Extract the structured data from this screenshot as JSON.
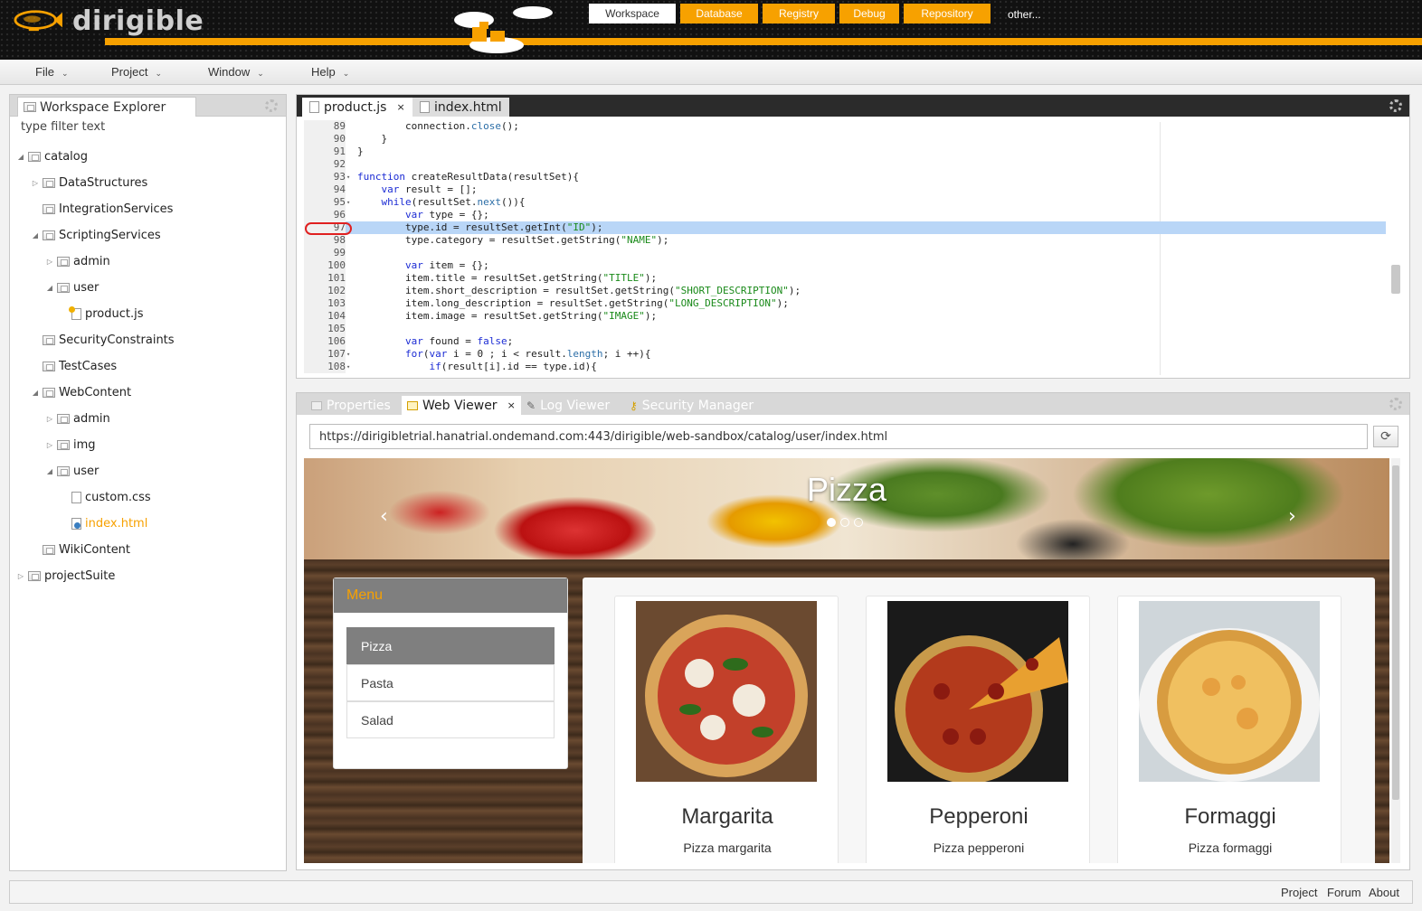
{
  "app": {
    "logo_text": "dirigible"
  },
  "top_tabs": [
    {
      "label": "Workspace",
      "active": true
    },
    {
      "label": "Database",
      "active": false
    },
    {
      "label": "Registry",
      "active": false
    },
    {
      "label": "Debug",
      "active": false
    },
    {
      "label": "Repository",
      "active": false
    }
  ],
  "other_link": "other...",
  "colors": {
    "accent": "#f7a100",
    "header_bg": "#111111",
    "highlight": "#b9d6f7",
    "breakpoint": "#e02020"
  },
  "menubar": {
    "file": "File",
    "project": "Project",
    "window": "Window",
    "help": "Help"
  },
  "explorer": {
    "title": "Workspace Explorer",
    "filter_placeholder": "type filter text",
    "tree": [
      {
        "label": "catalog",
        "icon": "project-folder-icon",
        "expanded": true
      },
      {
        "label": "DataStructures",
        "icon": "folder-icon",
        "expanded": false
      },
      {
        "label": "IntegrationServices",
        "icon": "folder-icon"
      },
      {
        "label": "ScriptingServices",
        "icon": "folder-icon",
        "expanded": true
      },
      {
        "label": "admin",
        "icon": "folder-icon",
        "expanded": false
      },
      {
        "label": "user",
        "icon": "folder-icon",
        "expanded": true
      },
      {
        "label": "product.js",
        "icon": "js-file-icon"
      },
      {
        "label": "SecurityConstraints",
        "icon": "folder-icon"
      },
      {
        "label": "TestCases",
        "icon": "folder-icon"
      },
      {
        "label": "WebContent",
        "icon": "folder-icon",
        "expanded": true
      },
      {
        "label": "admin",
        "icon": "folder-icon",
        "expanded": false
      },
      {
        "label": "img",
        "icon": "folder-icon",
        "expanded": false
      },
      {
        "label": "user",
        "icon": "folder-icon",
        "expanded": true
      },
      {
        "label": "custom.css",
        "icon": "css-file-icon"
      },
      {
        "label": "index.html",
        "icon": "html-file-icon",
        "selected": true
      },
      {
        "label": "WikiContent",
        "icon": "folder-icon"
      },
      {
        "label": "projectSuite",
        "icon": "project-folder-icon",
        "expanded": false
      }
    ]
  },
  "editor": {
    "tabs": [
      {
        "label": "product.js",
        "close": "×",
        "active": true
      },
      {
        "label": "index.html",
        "active": false
      }
    ],
    "highlighted_line": 97,
    "breakpoint_line": 97,
    "lines": [
      {
        "n": "89",
        "fold": "",
        "code": "        connection.close();"
      },
      {
        "n": "90",
        "fold": "",
        "code": "    }"
      },
      {
        "n": "91",
        "fold": "",
        "code": "}"
      },
      {
        "n": "92",
        "fold": "",
        "code": ""
      },
      {
        "n": "93",
        "fold": "▾",
        "code": "function createResultData(resultSet){"
      },
      {
        "n": "94",
        "fold": "",
        "code": "    var result = [];"
      },
      {
        "n": "95",
        "fold": "▾",
        "code": "    while(resultSet.next()){"
      },
      {
        "n": "96",
        "fold": "",
        "code": "        var type = {};"
      },
      {
        "n": "97",
        "fold": "",
        "code": "        type.id = resultSet.getInt(\"ID\");"
      },
      {
        "n": "98",
        "fold": "",
        "code": "        type.category = resultSet.getString(\"NAME\");"
      },
      {
        "n": "99",
        "fold": "",
        "code": ""
      },
      {
        "n": "100",
        "fold": "",
        "code": "        var item = {};"
      },
      {
        "n": "101",
        "fold": "",
        "code": "        item.title = resultSet.getString(\"TITLE\");"
      },
      {
        "n": "102",
        "fold": "",
        "code": "        item.short_description = resultSet.getString(\"SHORT_DESCRIPTION\");"
      },
      {
        "n": "103",
        "fold": "",
        "code": "        item.long_description = resultSet.getString(\"LONG_DESCRIPTION\");"
      },
      {
        "n": "104",
        "fold": "",
        "code": "        item.image = resultSet.getString(\"IMAGE\");"
      },
      {
        "n": "105",
        "fold": "",
        "code": ""
      },
      {
        "n": "106",
        "fold": "",
        "code": "        var found = false;"
      },
      {
        "n": "107",
        "fold": "▾",
        "code": "        for(var i = 0 ; i < result.length; i ++){"
      },
      {
        "n": "108",
        "fold": "▾",
        "code": "            if(result[i].id == type.id){"
      }
    ]
  },
  "bottom": {
    "tabs": [
      {
        "label": "Properties",
        "icon": "properties-icon",
        "active": false
      },
      {
        "label": "Web Viewer",
        "icon": "web-viewer-icon",
        "close": "×",
        "active": true
      },
      {
        "label": "Log Viewer",
        "icon": "pencil-icon",
        "active": false
      },
      {
        "label": "Security Manager",
        "icon": "key-icon",
        "active": false
      }
    ],
    "url": "https://dirigibletrial.hanatrial.ondemand.com:443/dirigible/web-sandbox/catalog/user/index.html",
    "refresh_icon": "refresh-icon"
  },
  "web": {
    "hero_title": "Pizza",
    "prev": "‹",
    "next": "›",
    "carousel_dots": 3,
    "carousel_active": 1,
    "menu_title": "Menu",
    "menu_items": [
      {
        "label": "Pizza",
        "active": true
      },
      {
        "label": "Pasta",
        "active": false
      },
      {
        "label": "Salad",
        "active": false
      }
    ],
    "products": [
      {
        "name": "Margarita",
        "desc": "Pizza margarita"
      },
      {
        "name": "Pepperoni",
        "desc": "Pizza pepperoni"
      },
      {
        "name": "Formaggi",
        "desc": "Pizza formaggi"
      }
    ]
  },
  "footer": {
    "project": "Project",
    "forum": "Forum",
    "about": "About"
  }
}
